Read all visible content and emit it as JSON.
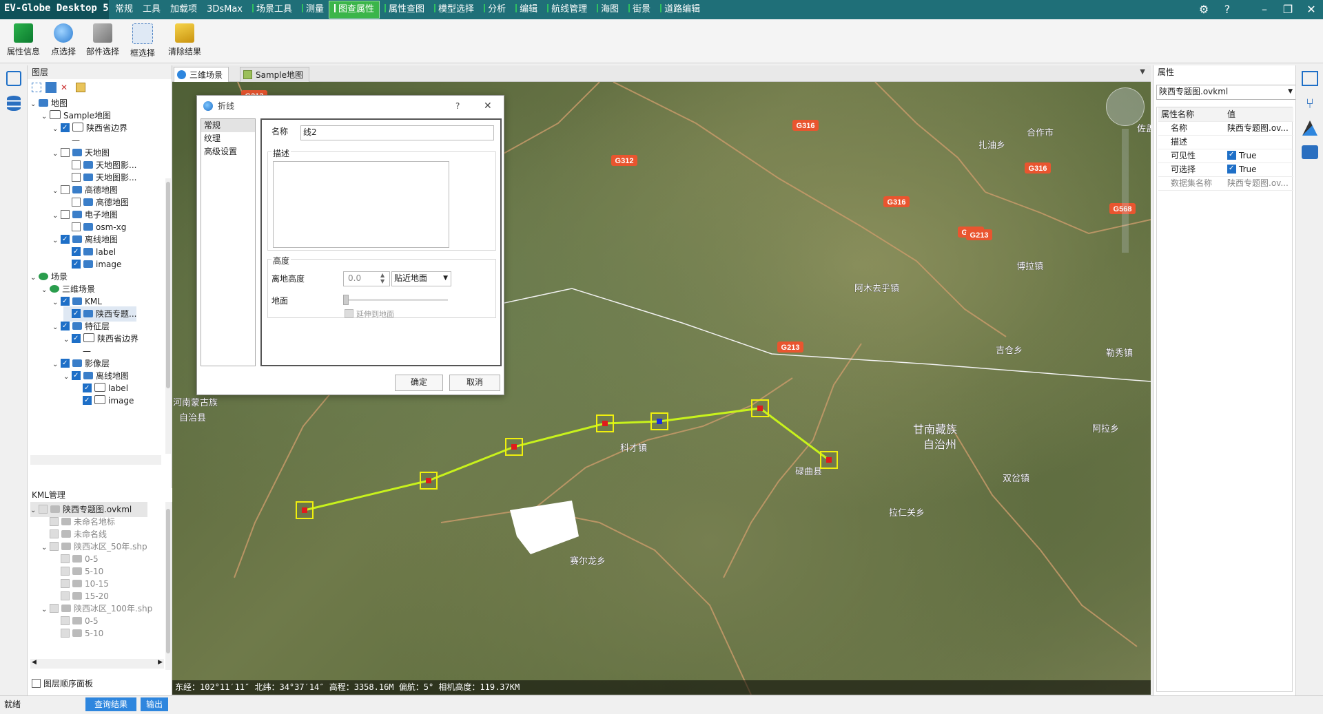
{
  "app": {
    "title": "EV-Globe Desktop 5"
  },
  "menu": {
    "items": [
      "常规",
      "工具",
      "加载项",
      "3DsMax",
      "场景工具",
      "测量",
      "图查属性",
      "属性查图",
      "模型选择",
      "分析",
      "编辑",
      "航线管理",
      "海图",
      "街景",
      "道路编辑"
    ],
    "active": "图查属性",
    "settings_icon": "gear-icon",
    "help_label": "?"
  },
  "ribbon": {
    "buttons": [
      "属性信息",
      "点选择",
      "部件选择",
      "框选择",
      "清除结果"
    ]
  },
  "layers": {
    "title": "图层",
    "tree": [
      {
        "label": "地图",
        "level": 0,
        "checked": null,
        "icon": "folder"
      },
      {
        "label": "Sample地图",
        "level": 1,
        "checked": null,
        "icon": "doc"
      },
      {
        "label": "陕西省边界",
        "level": 2,
        "checked": true,
        "icon": "doc"
      },
      {
        "label": "—",
        "level": 3,
        "checked": null,
        "icon": "none"
      },
      {
        "label": "天地图",
        "level": 2,
        "checked": false,
        "icon": "layers"
      },
      {
        "label": "天地图影...",
        "level": 3,
        "checked": false,
        "icon": "layer"
      },
      {
        "label": "天地图影...",
        "level": 3,
        "checked": false,
        "icon": "layer"
      },
      {
        "label": "高德地图",
        "level": 2,
        "checked": false,
        "icon": "layers"
      },
      {
        "label": "高德地图",
        "level": 3,
        "checked": false,
        "icon": "layer"
      },
      {
        "label": "电子地图",
        "level": 2,
        "checked": false,
        "icon": "layers"
      },
      {
        "label": "osm-xg",
        "level": 3,
        "checked": false,
        "icon": "layer"
      },
      {
        "label": "离线地图",
        "level": 2,
        "checked": true,
        "icon": "layers"
      },
      {
        "label": "label",
        "level": 3,
        "checked": true,
        "icon": "layer"
      },
      {
        "label": "image",
        "level": 3,
        "checked": true,
        "icon": "layer"
      },
      {
        "label": "场景",
        "level": 0,
        "checked": null,
        "icon": "globe"
      },
      {
        "label": "三维场景",
        "level": 1,
        "checked": null,
        "icon": "globe"
      },
      {
        "label": "KML",
        "level": 2,
        "checked": true,
        "icon": "kml"
      },
      {
        "label": "陕西专题...",
        "level": 3,
        "checked": true,
        "icon": "kml"
      },
      {
        "label": "特征层",
        "level": 2,
        "checked": true,
        "icon": "layers"
      },
      {
        "label": "陕西省边界",
        "level": 3,
        "checked": true,
        "icon": "doc"
      },
      {
        "label": "—",
        "level": 4,
        "checked": null,
        "icon": "none"
      },
      {
        "label": "影像层",
        "level": 2,
        "checked": true,
        "icon": "layers"
      },
      {
        "label": "离线地图",
        "level": 3,
        "checked": true,
        "icon": "layers"
      },
      {
        "label": "label",
        "level": 4,
        "checked": true,
        "icon": "doc"
      },
      {
        "label": "image",
        "level": 4,
        "checked": true,
        "icon": "doc"
      }
    ]
  },
  "kml": {
    "title": "KML管理",
    "tree": [
      {
        "label": "陕西专题图.ovkml",
        "level": 0
      },
      {
        "label": "未命名地标",
        "level": 1
      },
      {
        "label": "未命名线",
        "level": 1
      },
      {
        "label": "陕西冰区_50年.shp",
        "level": 1
      },
      {
        "label": "0-5",
        "level": 2
      },
      {
        "label": "5-10",
        "level": 2
      },
      {
        "label": "10-15",
        "level": 2
      },
      {
        "label": "15-20",
        "level": 2
      },
      {
        "label": "陕西冰区_100年.shp",
        "level": 1
      },
      {
        "label": "0-5",
        "level": 2
      },
      {
        "label": "5-10",
        "level": 2
      }
    ],
    "order_panel_label": "图层顺序面板"
  },
  "tabs": {
    "scene": "三维场景",
    "map": "Sample地图"
  },
  "map": {
    "road_labels": [
      "G213",
      "G312",
      "G316",
      "G316",
      "G316",
      "G316",
      "G568",
      "G213",
      "G213"
    ],
    "place_labels": [
      "合作市",
      "扎油乡",
      "博拉镇",
      "阿木去乎镇",
      "吉仓乡",
      "勒秀镇",
      "甘南藏族",
      "自治州",
      "河南蒙古族",
      "自治县",
      "科才镇",
      "碌曲县",
      "双岔镇",
      "拉仁关乡",
      "赛尔龙乡",
      "阿拉乡",
      "佐盖"
    ]
  },
  "status": {
    "text": "东经：102°11′11″  北纬：34°37′14″  高程：3358.16M  偏航：5°   相机高度：119.37KM"
  },
  "dialog": {
    "title": "折线",
    "help": "?",
    "nav": [
      "常规",
      "纹理",
      "高级设置"
    ],
    "name_label": "名称",
    "name_value": "线2",
    "desc_label": "描述",
    "height_group": "高度",
    "alt_label": "离地高度",
    "alt_value": "0.0",
    "alt_mode": "贴近地面",
    "ground_label": "地面",
    "extend_label": "延伸到地面",
    "ok": "确定",
    "cancel": "取消"
  },
  "properties": {
    "title": "属性",
    "selector": "陕西专题图.ovkml",
    "col_name": "属性名称",
    "col_value": "值",
    "rows": [
      {
        "k": "名称",
        "v": "陕西专题图.ov..."
      },
      {
        "k": "描述",
        "v": ""
      },
      {
        "k": "可见性",
        "v": "True"
      },
      {
        "k": "可选择",
        "v": "True"
      },
      {
        "k": "数据集名称",
        "v": "陕西专题图.ov..."
      }
    ]
  },
  "bottom": {
    "ready": "就绪",
    "tab_results": "查询结果",
    "tab_output": "输出"
  },
  "colors": {
    "titlebar": "#1f6f78",
    "active_menu": "#3bb54a",
    "polyline": "#c8f21c",
    "vertex": "#e8e80e",
    "accent": "#2e86de"
  }
}
